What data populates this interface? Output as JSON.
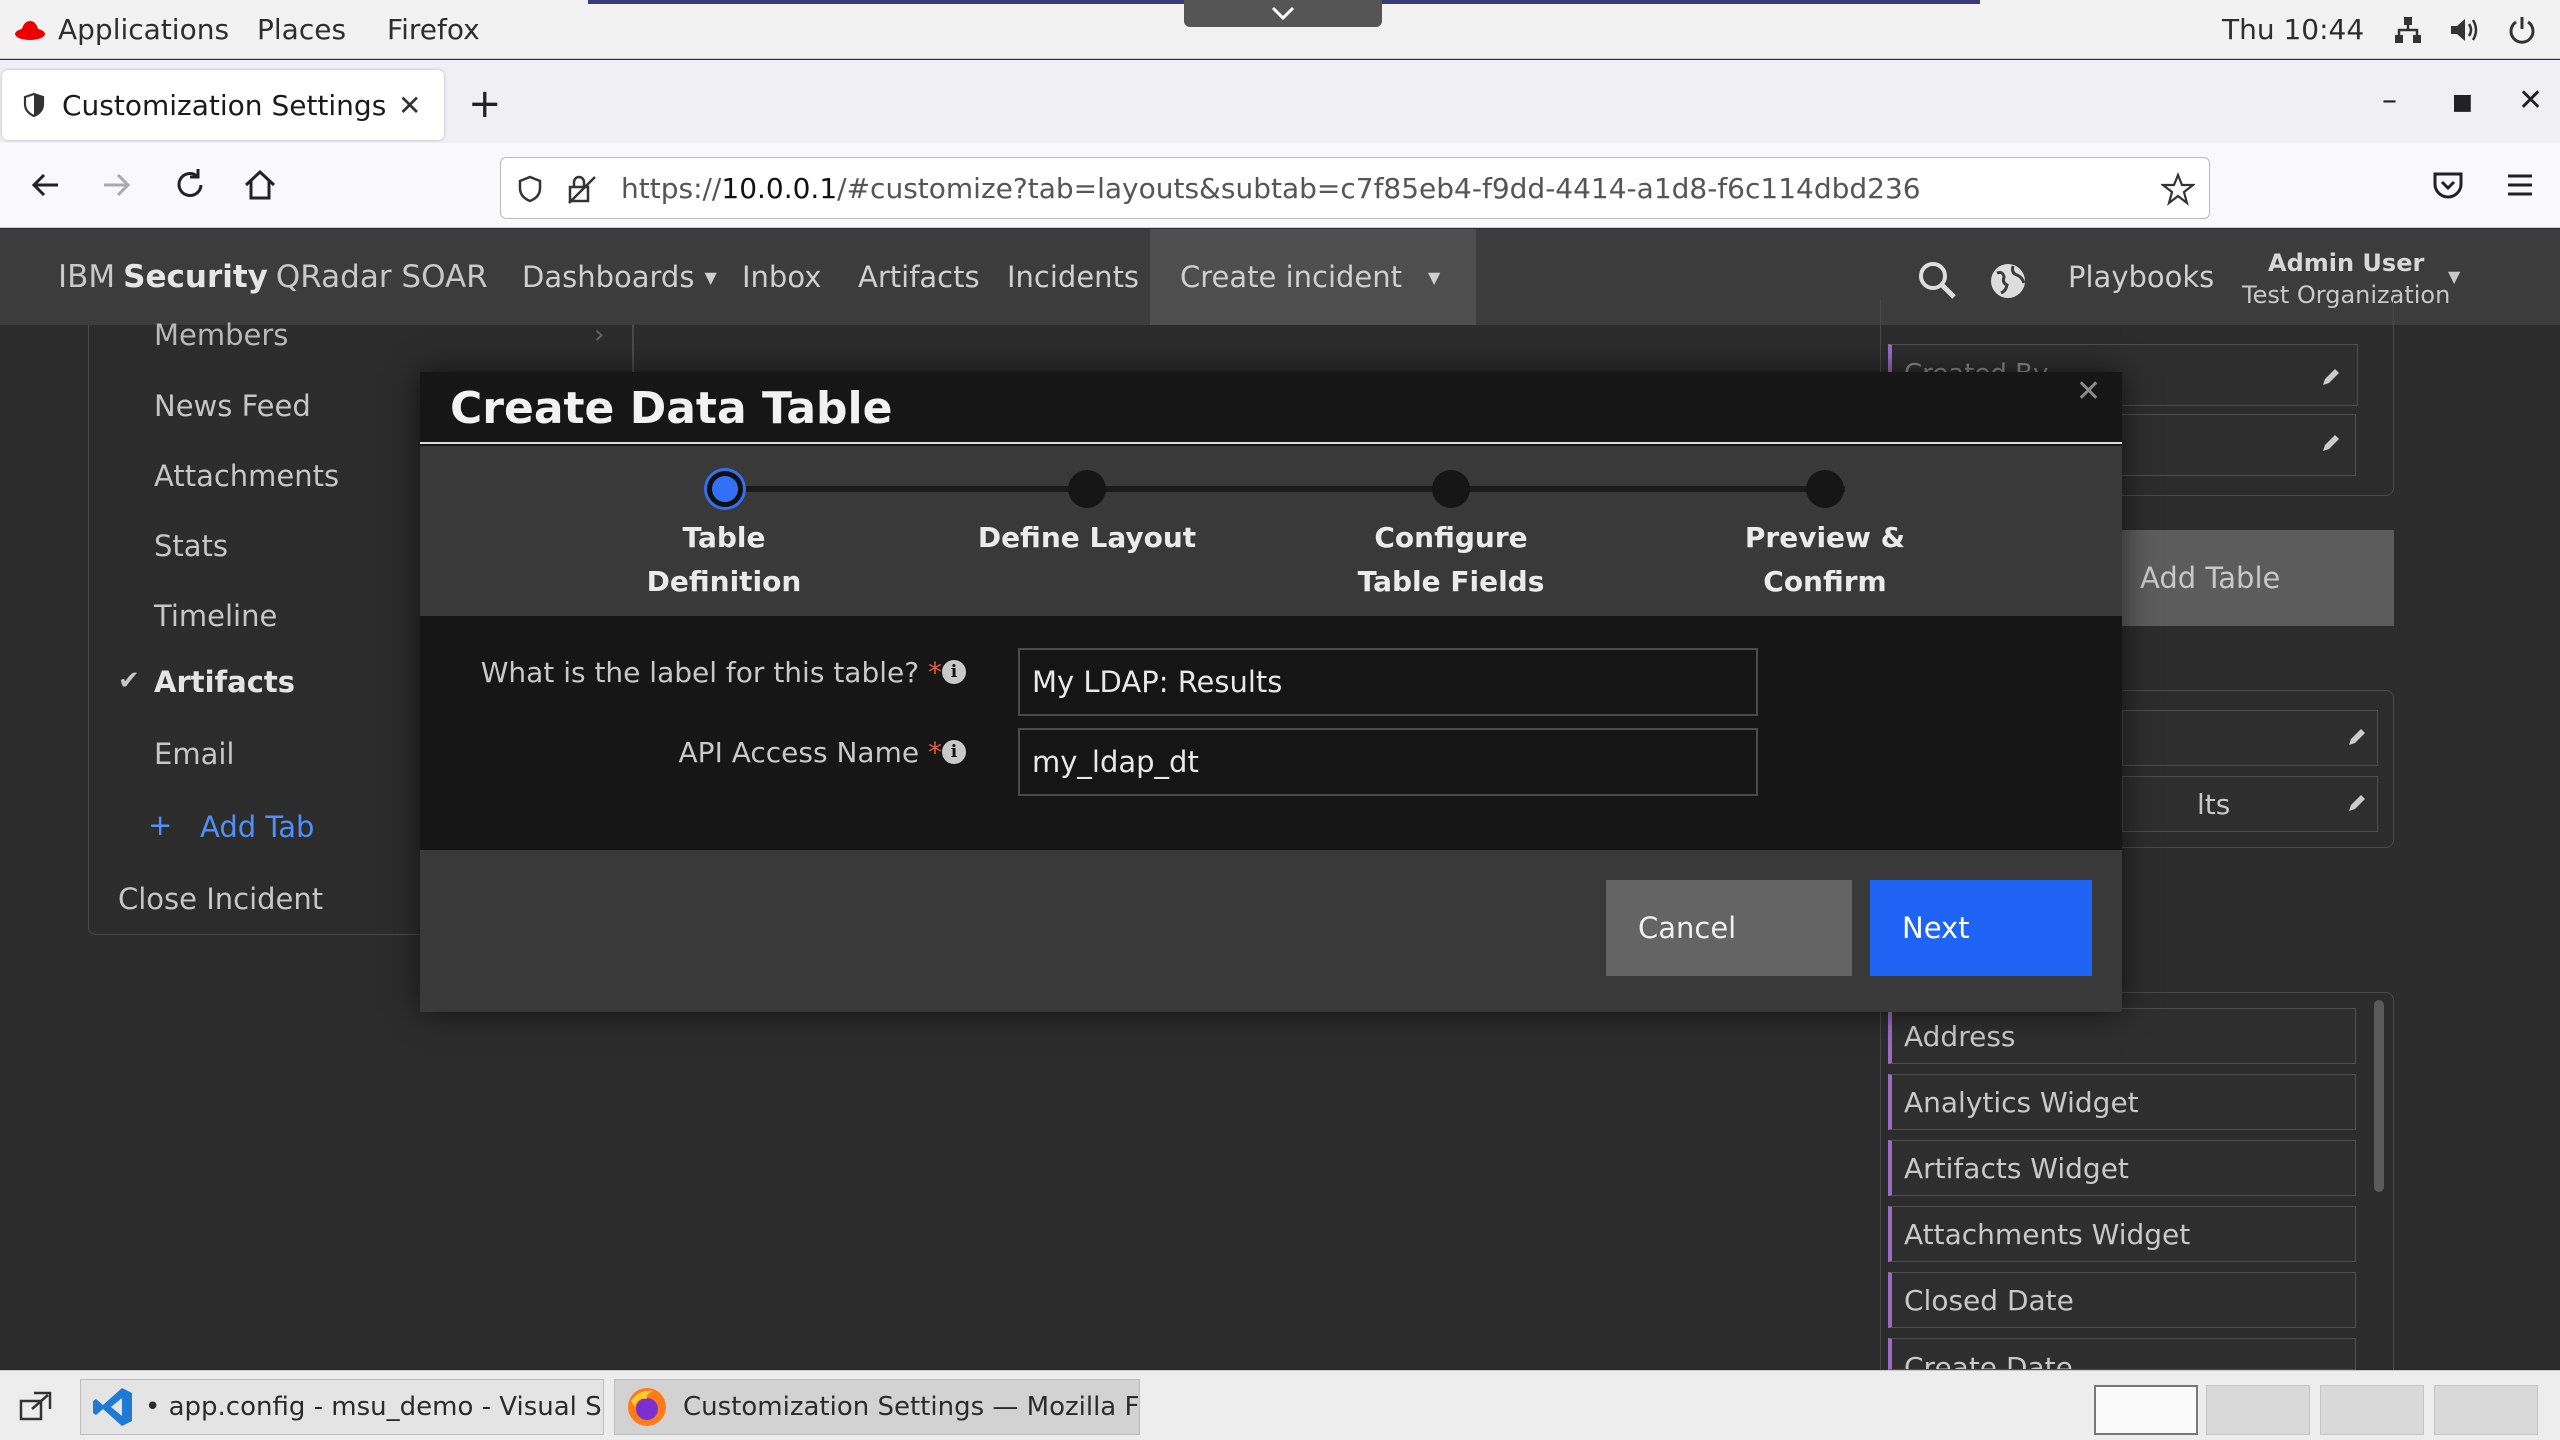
{
  "system_bar": {
    "applications": "Applications",
    "places": "Places",
    "firefox": "Firefox",
    "clock": "Thu 10:44"
  },
  "browser": {
    "tab_title": "Customization Settings",
    "url_prefix": "https://",
    "url_host": "10.0.0.1",
    "url_rest": "/#customize?tab=layouts&subtab=c7f85eb4-f9dd-4414-a1d8-f6c114dbd236"
  },
  "app_header": {
    "brand_ibm": "IBM",
    "brand_security": "Security",
    "brand_product": "QRadar SOAR",
    "nav": [
      "Dashboards",
      "Inbox",
      "Artifacts",
      "Incidents"
    ],
    "create_incident": "Create incident",
    "playbooks": "Playbooks",
    "user_name": "Admin User",
    "user_org": "Test Organization"
  },
  "left_panel": {
    "items": [
      "Members",
      "News Feed",
      "Attachments",
      "Stats",
      "Timeline",
      "Artifacts",
      "Email"
    ],
    "add_tab": "Add Tab",
    "close_incident": "Close Incident"
  },
  "right_panel": {
    "add_table": "Add Table",
    "partial_label": "lts",
    "partial_top": "Created By",
    "widgets": [
      "Address",
      "Analytics Widget",
      "Artifacts Widget",
      "Attachments Widget",
      "Closed Date",
      "Create Date"
    ]
  },
  "modal": {
    "title": "Create Data Table",
    "steps": [
      {
        "line1": "Table",
        "line2": "Definition"
      },
      {
        "line1": "Define Layout",
        "line2": ""
      },
      {
        "line1": "Configure",
        "line2": "Table Fields"
      },
      {
        "line1": "Preview &",
        "line2": "Confirm"
      }
    ],
    "fields": {
      "label_question": "What is the label for this table?",
      "label_value": "My LDAP: Results",
      "api_label": "API Access Name",
      "api_value": "my_ldap_dt",
      "required_mark": "*"
    },
    "cancel": "Cancel",
    "next": "Next"
  },
  "taskbar": {
    "vscode": "• app.config - msu_demo - Visual S...",
    "firefox": "Customization Settings — Mozilla Fi..."
  },
  "colors": {
    "accent_blue": "#1f63f5",
    "step_active": "#3370f5",
    "required_red": "#e0584c",
    "link_blue": "#4f8ff7"
  }
}
